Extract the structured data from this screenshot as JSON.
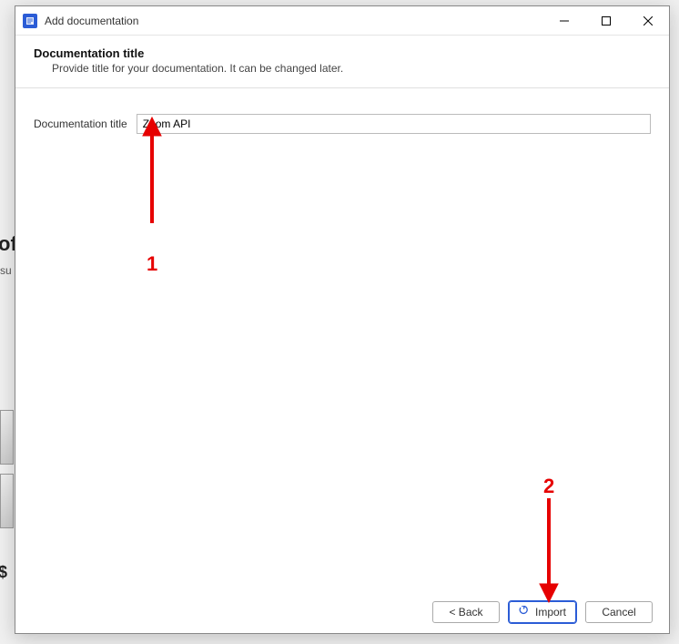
{
  "background": {
    "partial_heading_1": "of",
    "partial_text_1": "su",
    "partial_symbol": "$"
  },
  "dialog": {
    "title": "Add documentation",
    "header": {
      "title": "Documentation title",
      "description": "Provide title for your documentation. It can be changed later."
    },
    "form": {
      "title_label": "Documentation title",
      "title_value": "Zoom API"
    },
    "footer": {
      "back": "< Back",
      "import": "Import",
      "cancel": "Cancel"
    }
  },
  "annotations": {
    "one": "1",
    "two": "2"
  }
}
